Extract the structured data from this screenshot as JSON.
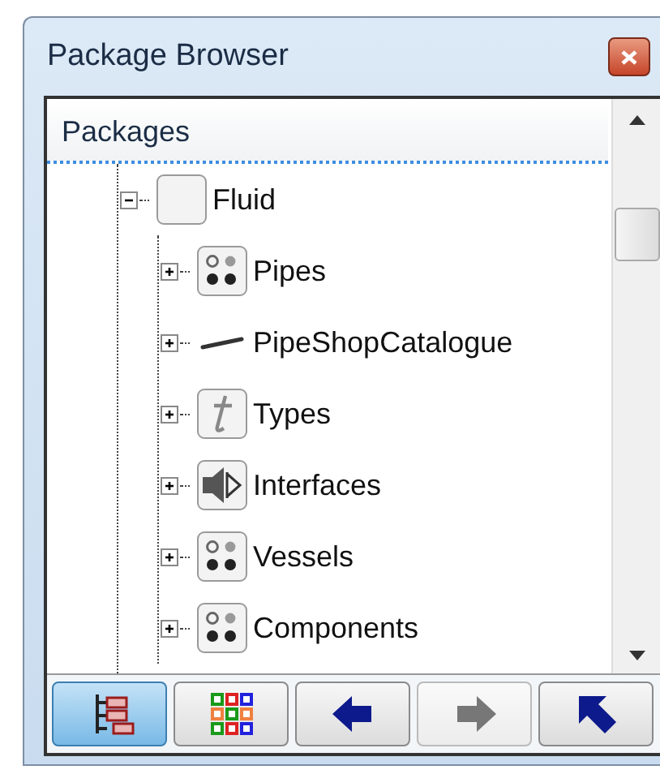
{
  "window": {
    "title": "Package Browser"
  },
  "header": "Packages",
  "tree": [
    {
      "label": "Fluid",
      "kind": "blank",
      "expanded": true,
      "children": [
        {
          "label": "Pipes",
          "kind": "package",
          "expanded": false
        },
        {
          "label": "PipeShopCatalogue",
          "kind": "pipe",
          "expanded": false
        },
        {
          "label": "Types",
          "kind": "types",
          "expanded": false
        },
        {
          "label": "Interfaces",
          "kind": "interface",
          "expanded": false
        },
        {
          "label": "Vessels",
          "kind": "package",
          "expanded": false
        },
        {
          "label": "Components",
          "kind": "package",
          "expanded": false
        }
      ]
    }
  ],
  "toolbar": [
    {
      "kind": "tree",
      "selected": true,
      "disabled": false
    },
    {
      "kind": "grid",
      "selected": false,
      "disabled": false
    },
    {
      "kind": "back",
      "selected": false,
      "disabled": false
    },
    {
      "kind": "forward",
      "selected": false,
      "disabled": true
    },
    {
      "kind": "up",
      "selected": false,
      "disabled": false
    }
  ]
}
